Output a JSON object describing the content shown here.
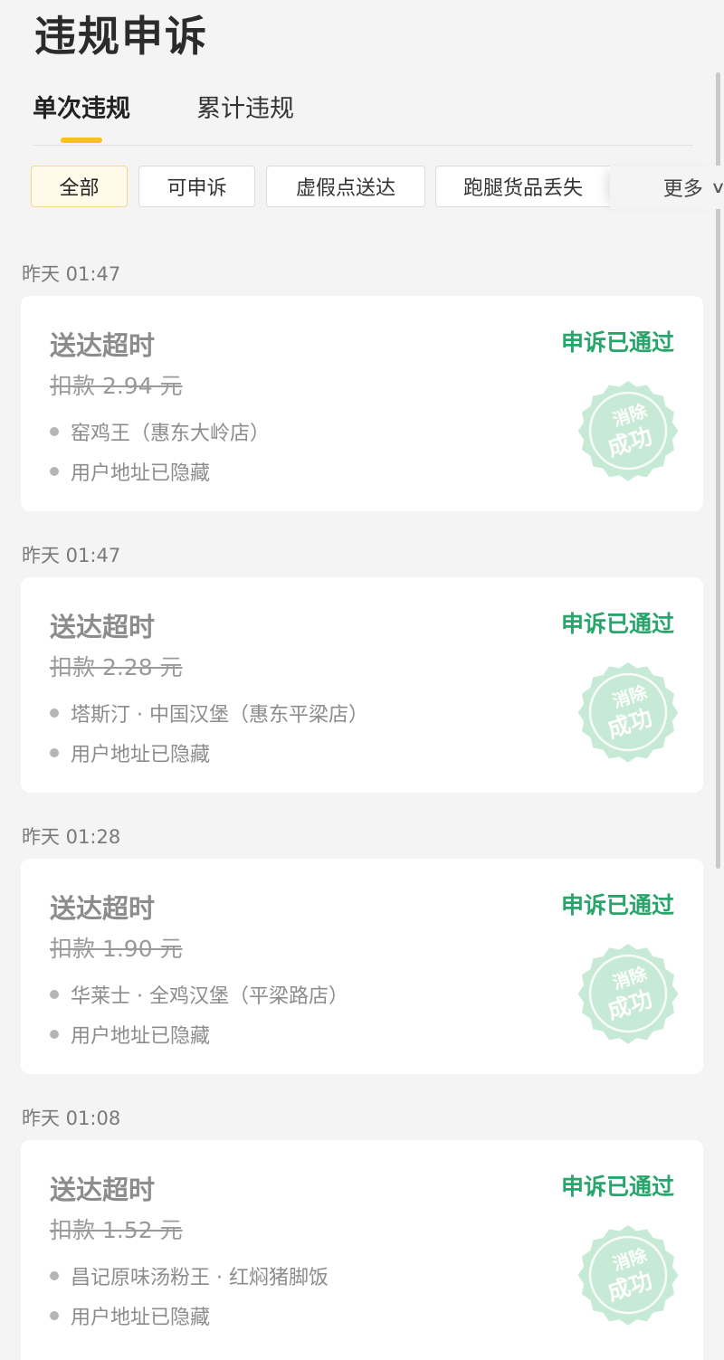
{
  "page": {
    "title": "违规申诉"
  },
  "tabs": [
    {
      "label": "单次违规",
      "active": true
    },
    {
      "label": "累计违规",
      "active": false
    }
  ],
  "filters": {
    "chips": [
      {
        "label": "全部",
        "active": true
      },
      {
        "label": "可申诉",
        "active": false
      },
      {
        "label": "虚假点送达",
        "active": false
      },
      {
        "label": "跑腿货品丢失",
        "active": false
      }
    ],
    "more_label": "更多"
  },
  "records": [
    {
      "time": "昨天 01:47",
      "title": "送达超时",
      "status": "申诉已通过",
      "deduction": "扣款 2.94 元",
      "store": "窑鸡王（惠东大岭店）",
      "address": "用户地址已隐藏",
      "stamp_top": "消除",
      "stamp_bottom": "成功"
    },
    {
      "time": "昨天 01:47",
      "title": "送达超时",
      "status": "申诉已通过",
      "deduction": "扣款 2.28 元",
      "store": "塔斯汀 · 中国汉堡（惠东平梁店）",
      "address": "用户地址已隐藏",
      "stamp_top": "消除",
      "stamp_bottom": "成功"
    },
    {
      "time": "昨天 01:28",
      "title": "送达超时",
      "status": "申诉已通过",
      "deduction": "扣款 1.90 元",
      "store": "华莱士 · 全鸡汉堡（平梁路店）",
      "address": "用户地址已隐藏",
      "stamp_top": "消除",
      "stamp_bottom": "成功"
    },
    {
      "time": "昨天 01:08",
      "title": "送达超时",
      "status": "申诉已通过",
      "deduction": "扣款 1.52 元",
      "store": "昌记原味汤粉王 · 红焖猪脚饭",
      "address": "用户地址已隐藏",
      "stamp_top": "消除",
      "stamp_bottom": "成功"
    }
  ],
  "colors": {
    "accent": "#f5c21d",
    "status_green": "#27a56a",
    "stamp_fill": "#c7ead6",
    "stamp_text": "#ffffff"
  },
  "icons": {
    "more": "chevron-down-icon",
    "stamp": "seal-stamp-icon"
  }
}
